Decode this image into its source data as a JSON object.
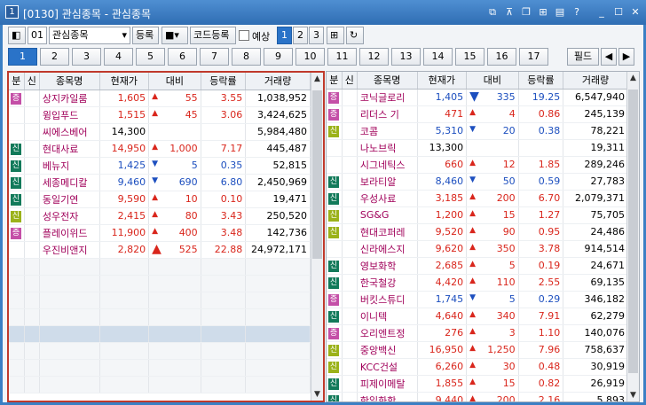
{
  "window": {
    "title": "[0130] 관심종목 - 관심종목",
    "app_icon": "1"
  },
  "toolbar": {
    "group_no": "01",
    "group_name": "관심종목",
    "register_label": "등록",
    "code_register_label": "코드등록",
    "forecast_label": "예상",
    "view_tabs": [
      "1",
      "2",
      "3"
    ],
    "selected_view": "1"
  },
  "pages": {
    "items": [
      "1",
      "2",
      "3",
      "4",
      "5",
      "6",
      "7",
      "8",
      "9",
      "10",
      "11",
      "12",
      "13",
      "14",
      "15",
      "16",
      "17"
    ],
    "selected": "1",
    "field_label": "필드"
  },
  "columns": [
    "분",
    "신",
    "종목명",
    "현재가",
    "대비",
    "등락률",
    "거래량"
  ],
  "left_rows": [
    {
      "tag": "jeung",
      "name": "상지카일룸",
      "price": "1,605",
      "dir": "up",
      "change": "55",
      "rate": "3.55",
      "volume": "1,038,952"
    },
    {
      "tag": "",
      "name": "윙입푸드",
      "price": "1,515",
      "dir": "up",
      "change": "45",
      "rate": "3.06",
      "volume": "3,424,625"
    },
    {
      "tag": "",
      "name": "씨에스베어",
      "price": "14,300",
      "dir": "",
      "change": "",
      "rate": "",
      "volume": "5,984,480"
    },
    {
      "tag": "sin",
      "name": "현대사료",
      "price": "14,950",
      "dir": "up",
      "change": "1,000",
      "rate": "7.17",
      "volume": "445,487"
    },
    {
      "tag": "sin",
      "name": "베뉴지",
      "price": "1,425",
      "dir": "dn",
      "change": "5",
      "rate": "0.35",
      "volume": "52,815"
    },
    {
      "tag": "sin",
      "name": "세종메디칼",
      "price": "9,460",
      "dir": "dn",
      "change": "690",
      "rate": "6.80",
      "volume": "2,450,969"
    },
    {
      "tag": "sin",
      "name": "동일기연",
      "price": "9,590",
      "dir": "up",
      "change": "10",
      "rate": "0.10",
      "volume": "19,471"
    },
    {
      "tag": "gwan",
      "name": "성우전자",
      "price": "2,415",
      "dir": "up",
      "change": "80",
      "rate": "3.43",
      "volume": "250,520"
    },
    {
      "tag": "jeung",
      "name": "플레이위드",
      "price": "11,900",
      "dir": "up",
      "change": "400",
      "rate": "3.48",
      "volume": "142,736"
    },
    {
      "tag": "",
      "name": "우진비앤지",
      "price": "2,820",
      "dir": "upbig",
      "change": "525",
      "rate": "22.88",
      "volume": "24,972,171"
    }
  ],
  "right_rows": [
    {
      "tag": "jeung",
      "name": "코닉글로리",
      "price": "1,405",
      "dir": "dnbig",
      "change": "335",
      "rate": "19.25",
      "volume": "6,547,940"
    },
    {
      "tag": "jeung",
      "name": "리더스 기",
      "price": "471",
      "dir": "up",
      "change": "4",
      "rate": "0.86",
      "volume": "245,139"
    },
    {
      "tag": "gwan",
      "name": "코콤",
      "price": "5,310",
      "dir": "dn",
      "change": "20",
      "rate": "0.38",
      "volume": "78,221"
    },
    {
      "tag": "",
      "name": "나노브릭",
      "price": "13,300",
      "dir": "",
      "change": "",
      "rate": "",
      "volume": "19,311"
    },
    {
      "tag": "",
      "name": "시그네틱스",
      "price": "660",
      "dir": "up",
      "change": "12",
      "rate": "1.85",
      "volume": "289,246"
    },
    {
      "tag": "sin",
      "name": "보라티알",
      "price": "8,460",
      "dir": "dn",
      "change": "50",
      "rate": "0.59",
      "volume": "27,783"
    },
    {
      "tag": "sin",
      "name": "우성사료",
      "price": "3,185",
      "dir": "up",
      "change": "200",
      "rate": "6.70",
      "volume": "2,079,371"
    },
    {
      "tag": "gwan",
      "name": "SG&G",
      "price": "1,200",
      "dir": "up",
      "change": "15",
      "rate": "1.27",
      "volume": "75,705"
    },
    {
      "tag": "gwan",
      "name": "현대코퍼레",
      "price": "9,520",
      "dir": "up",
      "change": "90",
      "rate": "0.95",
      "volume": "24,486"
    },
    {
      "tag": "",
      "name": "신라에스지",
      "price": "9,620",
      "dir": "up",
      "change": "350",
      "rate": "3.78",
      "volume": "914,514"
    },
    {
      "tag": "sin",
      "name": "영보화학",
      "price": "2,685",
      "dir": "up",
      "change": "5",
      "rate": "0.19",
      "volume": "24,671"
    },
    {
      "tag": "sin",
      "name": "한국철강",
      "price": "4,420",
      "dir": "up",
      "change": "110",
      "rate": "2.55",
      "volume": "69,135"
    },
    {
      "tag": "jeung",
      "name": "버킷스튜디",
      "price": "1,745",
      "dir": "dn",
      "change": "5",
      "rate": "0.29",
      "volume": "346,182"
    },
    {
      "tag": "sin",
      "name": "이니텍",
      "price": "4,640",
      "dir": "up",
      "change": "340",
      "rate": "7.91",
      "volume": "62,279"
    },
    {
      "tag": "jeung",
      "name": "오리엔트정",
      "price": "276",
      "dir": "up",
      "change": "3",
      "rate": "1.10",
      "volume": "140,076"
    },
    {
      "tag": "gwan",
      "name": "중앙백신",
      "price": "16,950",
      "dir": "up",
      "change": "1,250",
      "rate": "7.96",
      "volume": "758,637"
    },
    {
      "tag": "gwan",
      "name": "KCC건설",
      "price": "6,260",
      "dir": "up",
      "change": "30",
      "rate": "0.48",
      "volume": "30,919"
    },
    {
      "tag": "sin",
      "name": "피제이메탈",
      "price": "1,855",
      "dir": "up",
      "change": "15",
      "rate": "0.82",
      "volume": "26,919"
    },
    {
      "tag": "sin",
      "name": "한일화학",
      "price": "9,440",
      "dir": "up",
      "change": "200",
      "rate": "2.16",
      "volume": "5,893"
    }
  ],
  "badge_labels": {
    "sin": "신",
    "jeung": "증",
    "gwan": "신"
  },
  "colors": {
    "up": "#d9261c",
    "down": "#1d4fbf",
    "name": "#a0005a",
    "selected": "#2a73c8"
  }
}
